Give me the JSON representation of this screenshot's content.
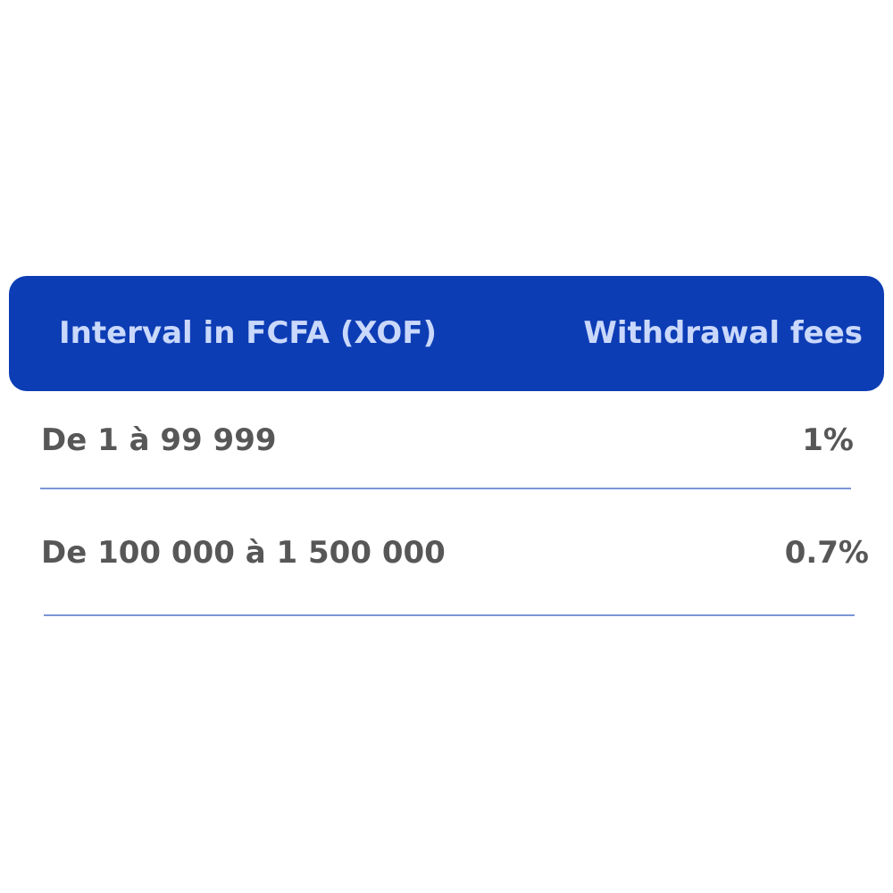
{
  "colors": {
    "header_bg": "#0d3db5",
    "header_text": "#c9d8fb",
    "row_text": "#575757",
    "divider": "#7b95d6"
  },
  "table": {
    "headers": [
      "Interval in FCFA (XOF)",
      "Withdrawal fees"
    ],
    "rows": [
      {
        "interval": "De 1 à 99 999",
        "fee": "1%"
      },
      {
        "interval": "De 100 000 à 1 500 000",
        "fee": "0.7%"
      }
    ]
  }
}
